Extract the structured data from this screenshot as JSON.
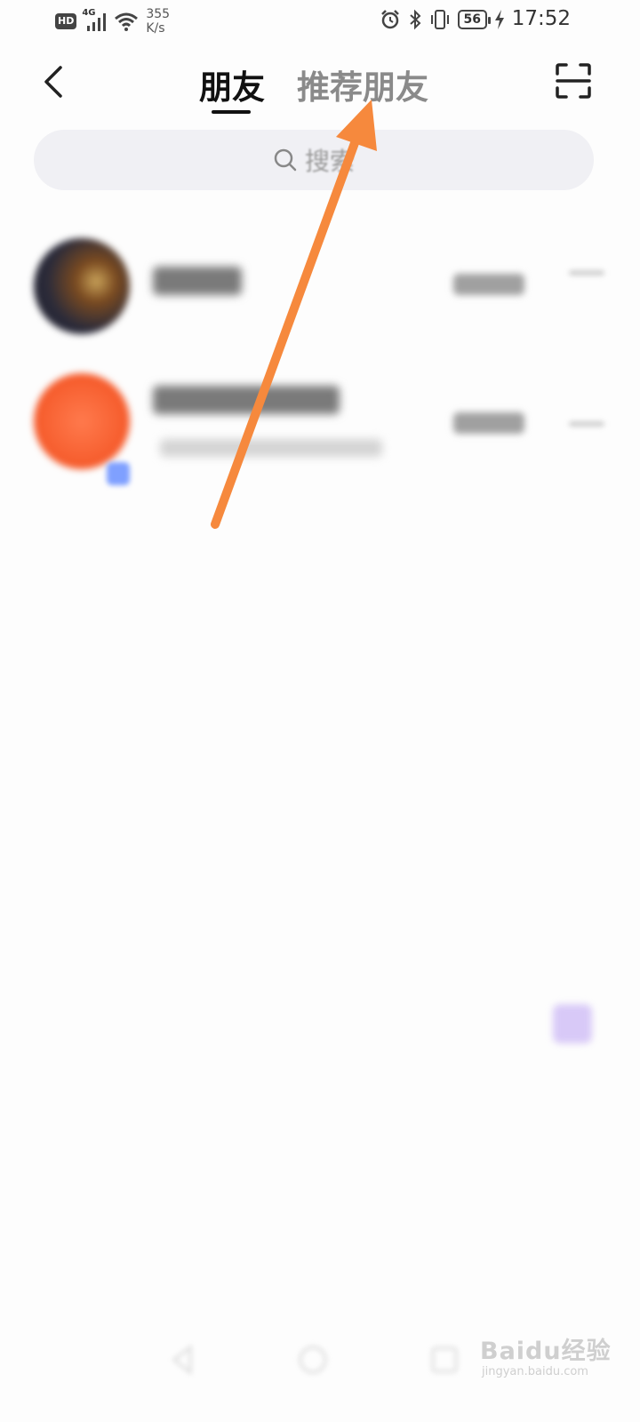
{
  "status_bar": {
    "hd": "HD",
    "network": "4G",
    "speed_value": "355",
    "speed_unit": "K/s",
    "battery": "56",
    "time": "17:52"
  },
  "header": {
    "tab_friends": "朋友",
    "tab_recommend": "推荐朋友"
  },
  "search": {
    "placeholder": "搜索"
  },
  "colors": {
    "annotation_arrow": "#f6893d",
    "active_tab": "#111111",
    "inactive_tab": "#8a8a8a"
  },
  "watermark": {
    "brand": "Baidu经验",
    "url": "jingyan.baidu.com"
  }
}
